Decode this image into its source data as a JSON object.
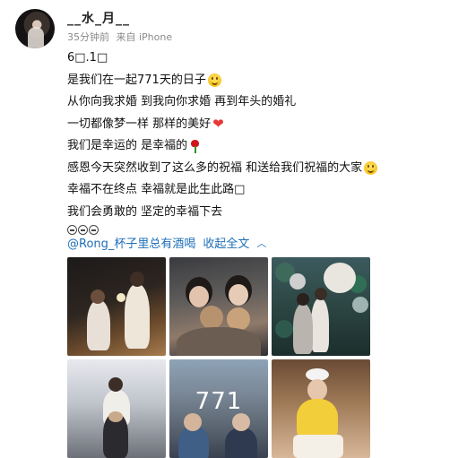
{
  "user": {
    "name": "__水_月__",
    "avatar_icon": "avatar"
  },
  "meta": {
    "time": "35分钟前",
    "source": "来自 iPhone"
  },
  "post": {
    "lines": [
      "6□.1□",
      "是我们在一起771天的日子",
      "从你向我求婚 到我向你求婚 再到年头的婚礼",
      "一切都像梦一样 那样的美好",
      "我们是幸运的 是幸福的",
      "感恩今天突然收到了这么多的祝福 和送给我们祝福的大家",
      "幸福不在终点 幸福就是此生此路□",
      "我们会勇敢的 坚定的幸福下去"
    ]
  },
  "mention": "@Rong_杯子里总有酒喝",
  "collapse_label": "收起全文",
  "photo5_text": "771",
  "icons": {
    "collapse": "chevron-up-icon",
    "smile": "smile-emoji",
    "heart": "heart-emoji",
    "rose": "rose-emoji"
  }
}
